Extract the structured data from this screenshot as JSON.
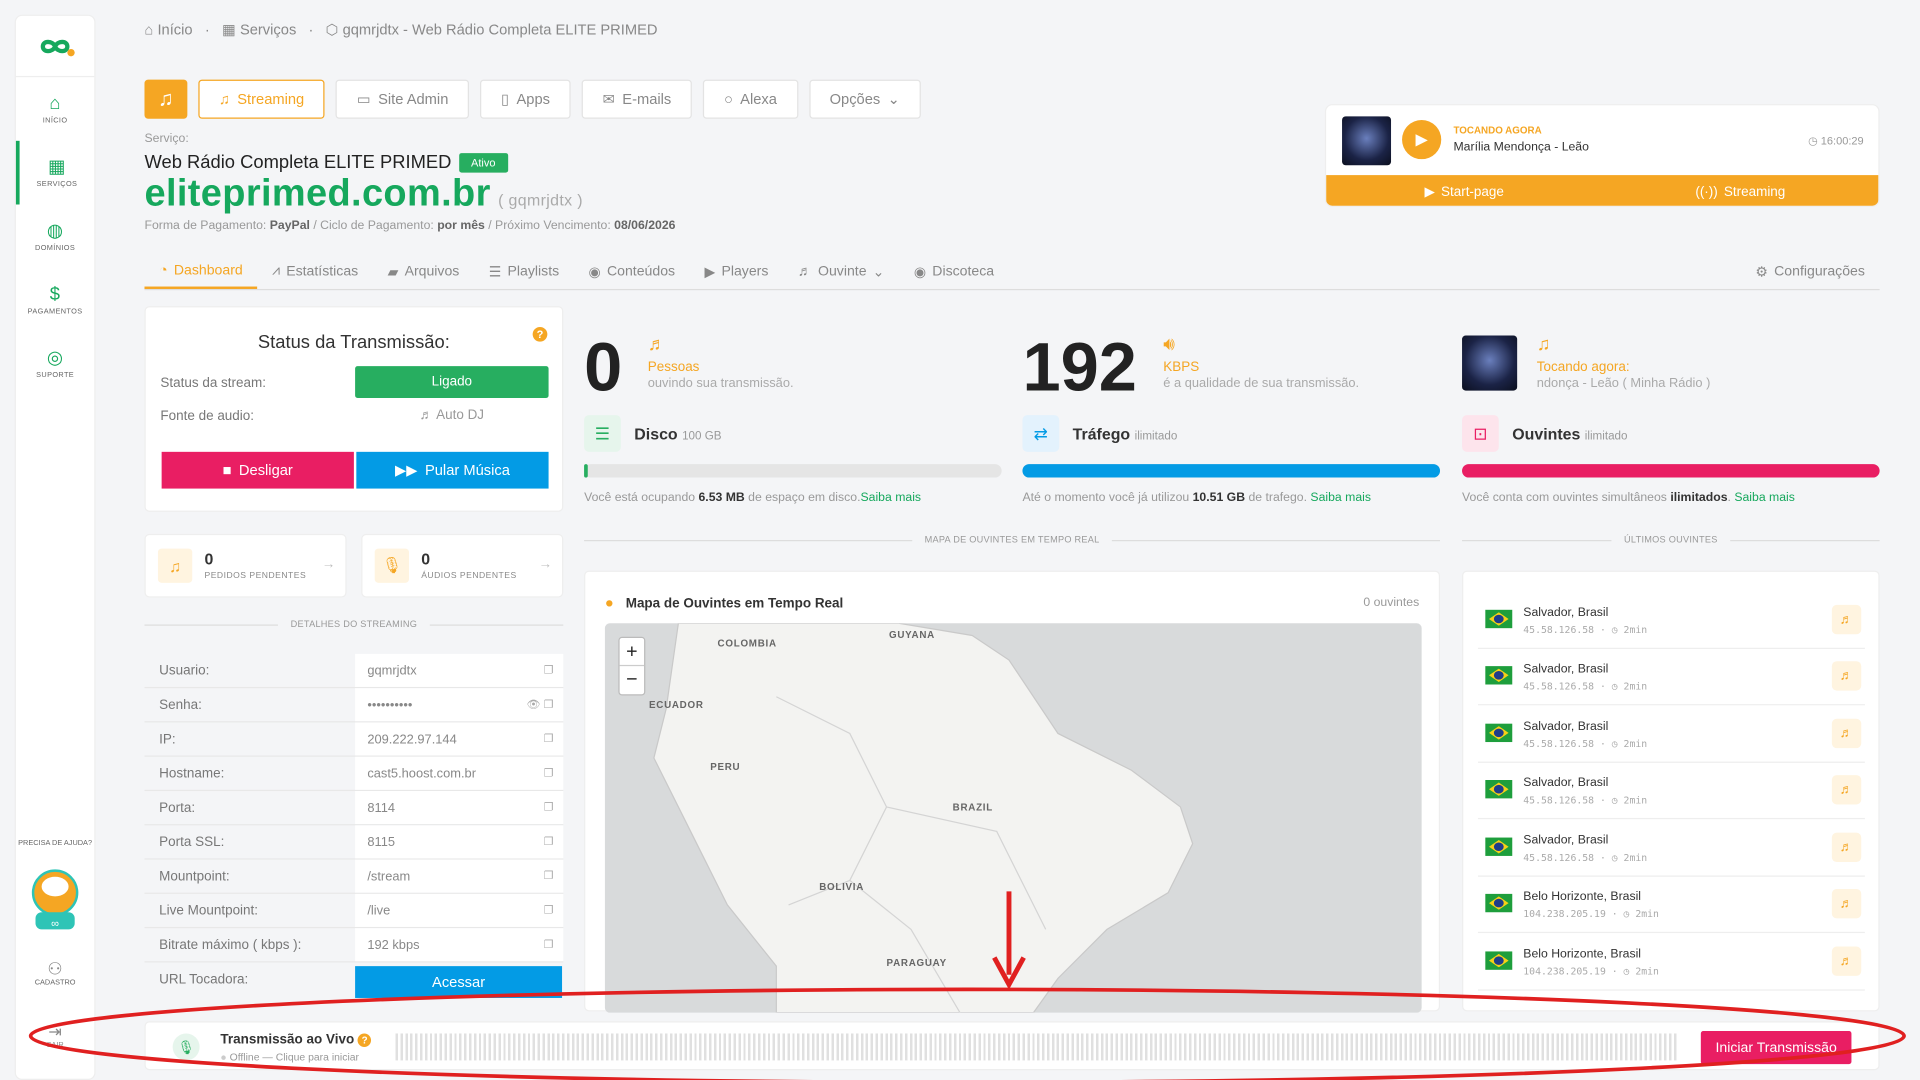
{
  "sidebar": {
    "items": [
      {
        "label": "INÍCIO",
        "icon": "home-icon"
      },
      {
        "label": "SERVIÇOS",
        "icon": "grid-icon"
      },
      {
        "label": "DOMÍNIOS",
        "icon": "globe-icon"
      },
      {
        "label": "PAGAMENTOS",
        "icon": "dollar-icon"
      },
      {
        "label": "SUPORTE",
        "icon": "lifebuoy-icon"
      }
    ],
    "help": "PRECISA DE AJUDA?",
    "cadastro": "CADASTRO",
    "sair": "SAIR"
  },
  "breadcrumb": {
    "home": "Início",
    "services": "Serviços",
    "current": "gqmrjdtx - Web Rádio Completa ELITE PRIMED"
  },
  "topTabs": [
    "Streaming",
    "Site Admin",
    "Apps",
    "E-mails",
    "Alexa",
    "Opções"
  ],
  "service": {
    "label": "Serviço:",
    "name": "Web Rádio Completa ELITE PRIMED",
    "status": "Ativo",
    "domain": "eliteprimed.com.br",
    "user": "( gqmrjdtx )",
    "pay_label": "Forma de Pagamento:",
    "pay": "PayPal",
    "cycle_label": "/ Ciclo de Pagamento:",
    "cycle": "por mês",
    "due_label": "/ Próximo Vencimento:",
    "due": "08/06/2026"
  },
  "player": {
    "now_label": "TOCANDO AGORA",
    "song": "Marília Mendonça - Leão",
    "time": "16:00:29",
    "startpage": "Start-page",
    "streaming": "Streaming"
  },
  "navTabs": [
    "Dashboard",
    "Estatísticas",
    "Arquivos",
    "Playlists",
    "Conteúdos",
    "Players",
    "Ouvinte",
    "Discoteca"
  ],
  "settings": "Configurações",
  "status": {
    "title": "Status da Transmissão:",
    "stream_label": "Status da stream:",
    "stream_value": "Ligado",
    "source_label": "Fonte de audio:",
    "source_value": "Auto DJ",
    "off_btn": "Desligar",
    "skip_btn": "Pular Música"
  },
  "pending": [
    {
      "count": "0",
      "label": "PEDIDOS PENDENTES"
    },
    {
      "count": "0",
      "label": "ÁUDIOS PENDENTES"
    }
  ],
  "details_label": "DETALHES DO STREAMING",
  "details": [
    {
      "k": "Usuario:",
      "v": "gqmrjdtx"
    },
    {
      "k": "Senha:",
      "v": "••••••••••"
    },
    {
      "k": "IP:",
      "v": "209.222.97.144"
    },
    {
      "k": "Hostname:",
      "v": "cast5.hoost.com.br"
    },
    {
      "k": "Porta:",
      "v": "8114"
    },
    {
      "k": "Porta SSL:",
      "v": "8115"
    },
    {
      "k": "Mountpoint:",
      "v": "/stream"
    },
    {
      "k": "Live Mountpoint:",
      "v": "/live"
    },
    {
      "k": "Bitrate máximo ( kbps ):",
      "v": "192 kbps"
    }
  ],
  "url_label": "URL Tocadora:",
  "url_btn": "Acessar",
  "stats": {
    "listeners": {
      "value": "0",
      "label": "Pessoas",
      "sub": "ouvindo sua transmissão."
    },
    "kbps": {
      "value": "192",
      "label": "KBPS",
      "sub": "é a qualidade de sua transmissão."
    },
    "now": {
      "label": "Tocando agora:",
      "sub": "ndonça - Leão ( Minha Rádio )"
    }
  },
  "metrics": {
    "disk": {
      "title": "Disco",
      "cap": "100 GB",
      "pre": "Você está ocupando",
      "val": "6.53 MB",
      "post": "de espaço em disco.",
      "link": "Saiba mais",
      "percent": 1
    },
    "traffic": {
      "title": "Tráfego",
      "cap": "ilimitado",
      "pre": "Até o momento você já utilizou",
      "val": "10.51 GB",
      "post": "de trafego.",
      "link": "Saiba mais",
      "percent": 100
    },
    "listeners": {
      "title": "Ouvintes",
      "cap": "ilimitado",
      "pre": "Você conta com ouvintes simultâneos",
      "val": "ilimitados",
      "post": ".",
      "link": "Saiba mais",
      "percent": 100
    }
  },
  "map": {
    "section": "MAPA DE OUVINTES EM TEMPO REAL",
    "title": "Mapa de Ouvintes em Tempo Real",
    "count": "0 ouvintes",
    "labels": [
      "COLOMBIA",
      "GUYANA",
      "ECUADOR",
      "PERU",
      "BRAZIL",
      "BOLIVIA",
      "PARAGUAY"
    ]
  },
  "last": {
    "section": "ÚLTIMOS OUVINTES",
    "items": [
      {
        "city": "Salvador, Brasil",
        "ip": "45.58.126.58",
        "ago": "2min"
      },
      {
        "city": "Salvador, Brasil",
        "ip": "45.58.126.58",
        "ago": "2min"
      },
      {
        "city": "Salvador, Brasil",
        "ip": "45.58.126.58",
        "ago": "2min"
      },
      {
        "city": "Salvador, Brasil",
        "ip": "45.58.126.58",
        "ago": "2min"
      },
      {
        "city": "Salvador, Brasil",
        "ip": "45.58.126.58",
        "ago": "2min"
      },
      {
        "city": "Belo Horizonte, Brasil",
        "ip": "104.238.205.19",
        "ago": "2min"
      },
      {
        "city": "Belo Horizonte, Brasil",
        "ip": "104.238.205.19",
        "ago": "2min"
      }
    ]
  },
  "live": {
    "title": "Transmissão ao Vivo",
    "status": "Offline — Clique para iniciar",
    "button": "Iniciar Transmissão"
  },
  "colors": {
    "green": "#16a85d",
    "orange": "#f5a623",
    "pink": "#e91e63",
    "blue": "#039be5"
  }
}
